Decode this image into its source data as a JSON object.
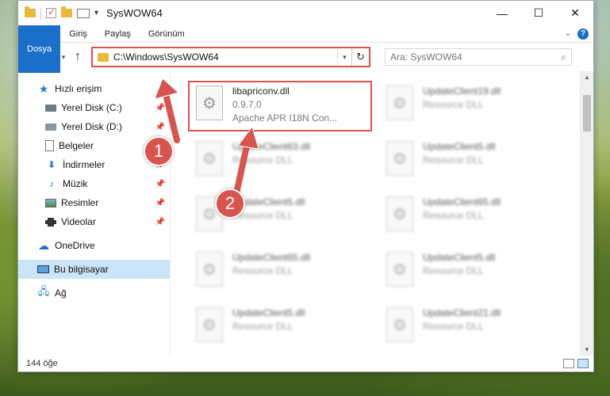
{
  "window": {
    "title": "SysWOW64",
    "controls": {
      "minimize": "—",
      "maximize": "☐",
      "close": "✕"
    }
  },
  "ribbon": {
    "tabs": [
      {
        "label": "Dosya",
        "active": true
      },
      {
        "label": "Giriş"
      },
      {
        "label": "Paylaş"
      },
      {
        "label": "Görünüm"
      }
    ],
    "help": "?"
  },
  "navigation": {
    "address": "C:\\Windows\\SysWOW64",
    "search_placeholder": "Ara: SysWOW64"
  },
  "sidebar": {
    "items": [
      {
        "label": "Hızlı erişim",
        "icon": "star-icon"
      },
      {
        "label": "Yerel Disk (C:)",
        "icon": "drive-icon",
        "pinned": true
      },
      {
        "label": "Yerel Disk (D:)",
        "icon": "drive-icon",
        "pinned": true
      },
      {
        "label": "Belgeler",
        "icon": "document-icon",
        "pinned": true
      },
      {
        "label": "İndirmeler",
        "icon": "download-icon",
        "pinned": true
      },
      {
        "label": "Müzik",
        "icon": "music-icon",
        "pinned": true
      },
      {
        "label": "Resimler",
        "icon": "pictures-icon",
        "pinned": true
      },
      {
        "label": "Videolar",
        "icon": "video-icon",
        "pinned": true
      },
      {
        "label": "OneDrive",
        "icon": "cloud-icon"
      },
      {
        "label": "Bu bilgisayar",
        "icon": "computer-icon",
        "selected": true
      },
      {
        "label": "Ağ",
        "icon": "network-icon"
      }
    ]
  },
  "files": [
    {
      "name": "libapriconv.dll",
      "line2": "0.9.7.0",
      "line3": "Apache APR I18N Con...",
      "highlighted": true
    },
    {
      "name": "UpdateClient19.dll",
      "line2": "Resource DLL"
    },
    {
      "name": "UpdateClient63.dll",
      "line2": "Resource DLL"
    },
    {
      "name": "UpdateClient5.dll",
      "line2": "Resource DLL"
    },
    {
      "name": "UpdateClient5.dll",
      "line2": "Resource DLL"
    },
    {
      "name": "UpdateClient65.dll",
      "line2": "Resource DLL"
    },
    {
      "name": "UpdateClient65.dll",
      "line2": "Resource DLL"
    },
    {
      "name": "UpdateClient5.dll",
      "line2": "Resource DLL"
    },
    {
      "name": "UpdateClient5.dll",
      "line2": "Resource DLL"
    },
    {
      "name": "UpdateClient21.dll",
      "line2": "Resource DLL"
    }
  ],
  "status": {
    "count": "144 öğe"
  },
  "annotations": {
    "step1": "1",
    "step2": "2"
  },
  "colors": {
    "accent": "#1a6fc9",
    "highlight_red": "#d9534f",
    "selected_bg": "#cce4f7"
  }
}
